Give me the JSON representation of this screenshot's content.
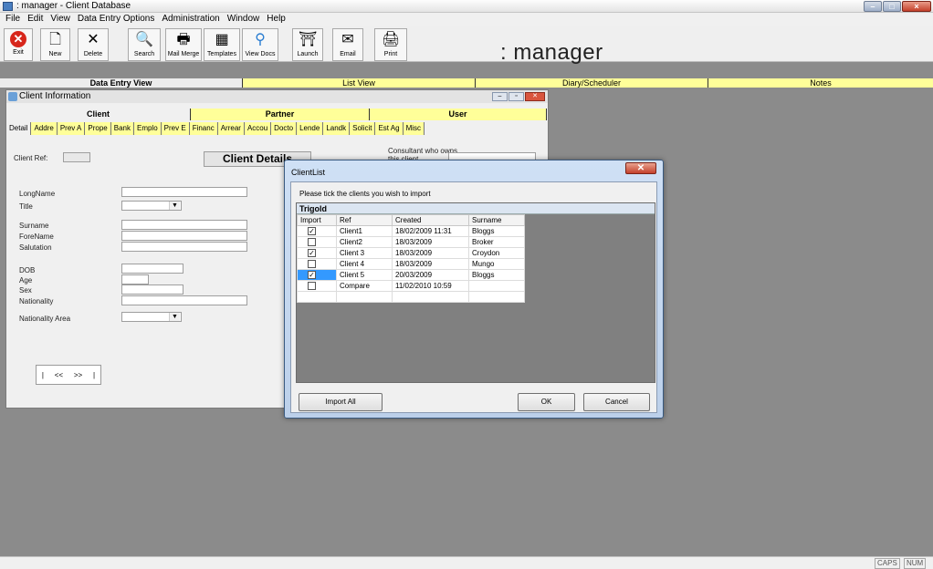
{
  "window": {
    "title": ": manager - Client Database"
  },
  "menu": [
    "File",
    "Edit",
    "View",
    "Data Entry Options",
    "Administration",
    "Window",
    "Help"
  ],
  "toolbar": {
    "buttons": [
      {
        "label": "Exit",
        "icon": "exit-icon"
      },
      {
        "label": "New",
        "icon": "new-document-icon"
      },
      {
        "label": "Delete",
        "icon": "delete-icon"
      },
      {
        "label": "Search",
        "icon": "search-icon"
      },
      {
        "label": "Mail Merge",
        "icon": "mail-merge-icon"
      },
      {
        "label": "Templates",
        "icon": "templates-icon"
      },
      {
        "label": "View Docs",
        "icon": "view-docs-icon"
      },
      {
        "label": "Launch",
        "icon": "launch-icon"
      },
      {
        "label": "Email",
        "icon": "email-icon"
      },
      {
        "label": "Print",
        "icon": "print-icon"
      }
    ],
    "brand": ": manager"
  },
  "main_tabs": [
    "Data Entry View",
    "List View",
    "Diary/Scheduler",
    "Notes"
  ],
  "client_window": {
    "title": "Client Information",
    "sub_tabs": [
      "Client",
      "Partner",
      "User"
    ],
    "detail_tabs": [
      "Detail",
      "Addre",
      "Prev A",
      "Prope",
      "Bank",
      "Emplo",
      "Prev E",
      "Financ",
      "Arrear",
      "Accou",
      "Docto",
      "Lende",
      "Landk",
      "Solicit",
      "Est Ag",
      "Misc"
    ],
    "client_ref_label": "Client Ref:",
    "client_details_heading": "Client Details",
    "consultant_label": "Consultant who owns this client",
    "fields": {
      "long_name": "LongName",
      "title": "Title",
      "surname": "Surname",
      "forename": "ForeName",
      "salutation": "Salutation",
      "dob": "DOB",
      "age": "Age",
      "sex": "Sex",
      "nationality": "Nationality",
      "nationality_area": "Nationality Area"
    },
    "nav": {
      "first": "|",
      "prev": "<<",
      "next": ">>",
      "last": "|"
    }
  },
  "client_list": {
    "title": "ClientList",
    "instruction": "Please tick the clients you wish to import",
    "group": "Trigold",
    "columns": [
      "Import",
      "Ref",
      "Created",
      "Surname"
    ],
    "rows": [
      {
        "checked": true,
        "ref": "Client1",
        "created": "18/02/2009 11:31",
        "surname": "Bloggs"
      },
      {
        "checked": false,
        "ref": "Client2",
        "created": "18/03/2009",
        "surname": "Broker"
      },
      {
        "checked": true,
        "ref": "Client 3",
        "created": "18/03/2009",
        "surname": "Croydon"
      },
      {
        "checked": false,
        "ref": "Client 4",
        "created": "18/03/2009",
        "surname": "Mungo"
      },
      {
        "checked": true,
        "ref": "Client 5",
        "created": "20/03/2009",
        "surname": "Bloggs"
      },
      {
        "checked": false,
        "ref": "Compare",
        "created": "11/02/2010 10:59",
        "surname": ""
      }
    ],
    "import_all": "Import All",
    "ok": "OK",
    "cancel": "Cancel"
  },
  "status": {
    "caps": "CAPS",
    "num": "NUM"
  },
  "colors": {
    "tab_yellow": "#ffff99",
    "desktop_gray": "#8b8b8b"
  }
}
